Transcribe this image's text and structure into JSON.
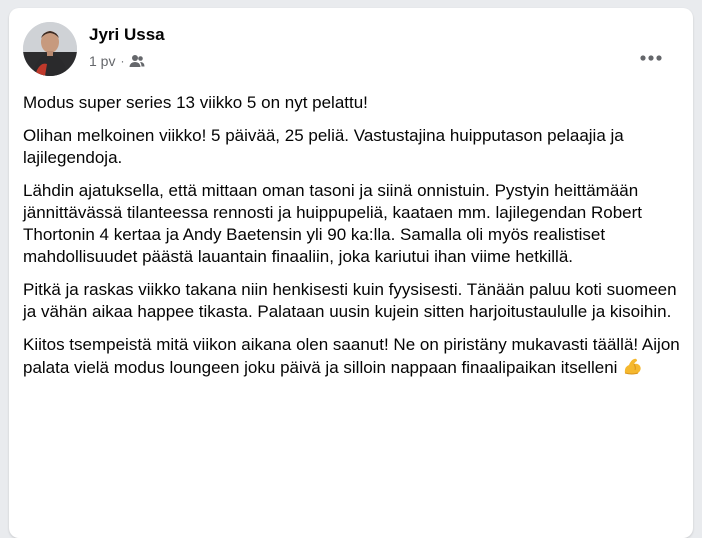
{
  "post": {
    "author": "Jyri Ussa",
    "time": "1 pv",
    "separator": "·",
    "audience_icon": "friends-icon",
    "more_icon": "more-horizontal-icon",
    "paragraphs": [
      "Modus super series 13 viikko 5 on nyt pelattu!",
      "Olihan melkoinen viikko! 5 päivää, 25 peliä. Vastustajina huipputason pelaajia ja lajilegendoja.",
      "Lähdin ajatuksella, että mittaan oman tasoni ja siinä onnistuin. Pystyin heittämään jännittävässä tilanteessa rennosti ja huippupeliä, kaataen mm. lajilegendan Robert Thortonin 4 kertaa ja Andy Baetensin yli 90 ka:lla. Samalla oli myös realistiset mahdollisuudet päästä lauantain finaaliin, joka kariutui ihan viime hetkillä.",
      "Pitkä ja raskas viikko takana niin henkisesti kuin fyysisesti. Tänään paluu koti suomeen ja vähän aikaa happee tikasta. Palataan uusin kujein sitten harjoitustaululle ja kisoihin.",
      "Kiitos tsempeistä mitä viikon aikana olen saanut! Ne on piristäny mukavasti täällä! Aijon palata vielä modus loungeen joku päivä ja silloin nappaan finaalipaikan itselleni"
    ],
    "trailing_emoji": "flexed-biceps-icon"
  },
  "colors": {
    "background": "#e9ebee",
    "card": "#ffffff",
    "text": "#050505",
    "secondary_text": "#65676b"
  }
}
